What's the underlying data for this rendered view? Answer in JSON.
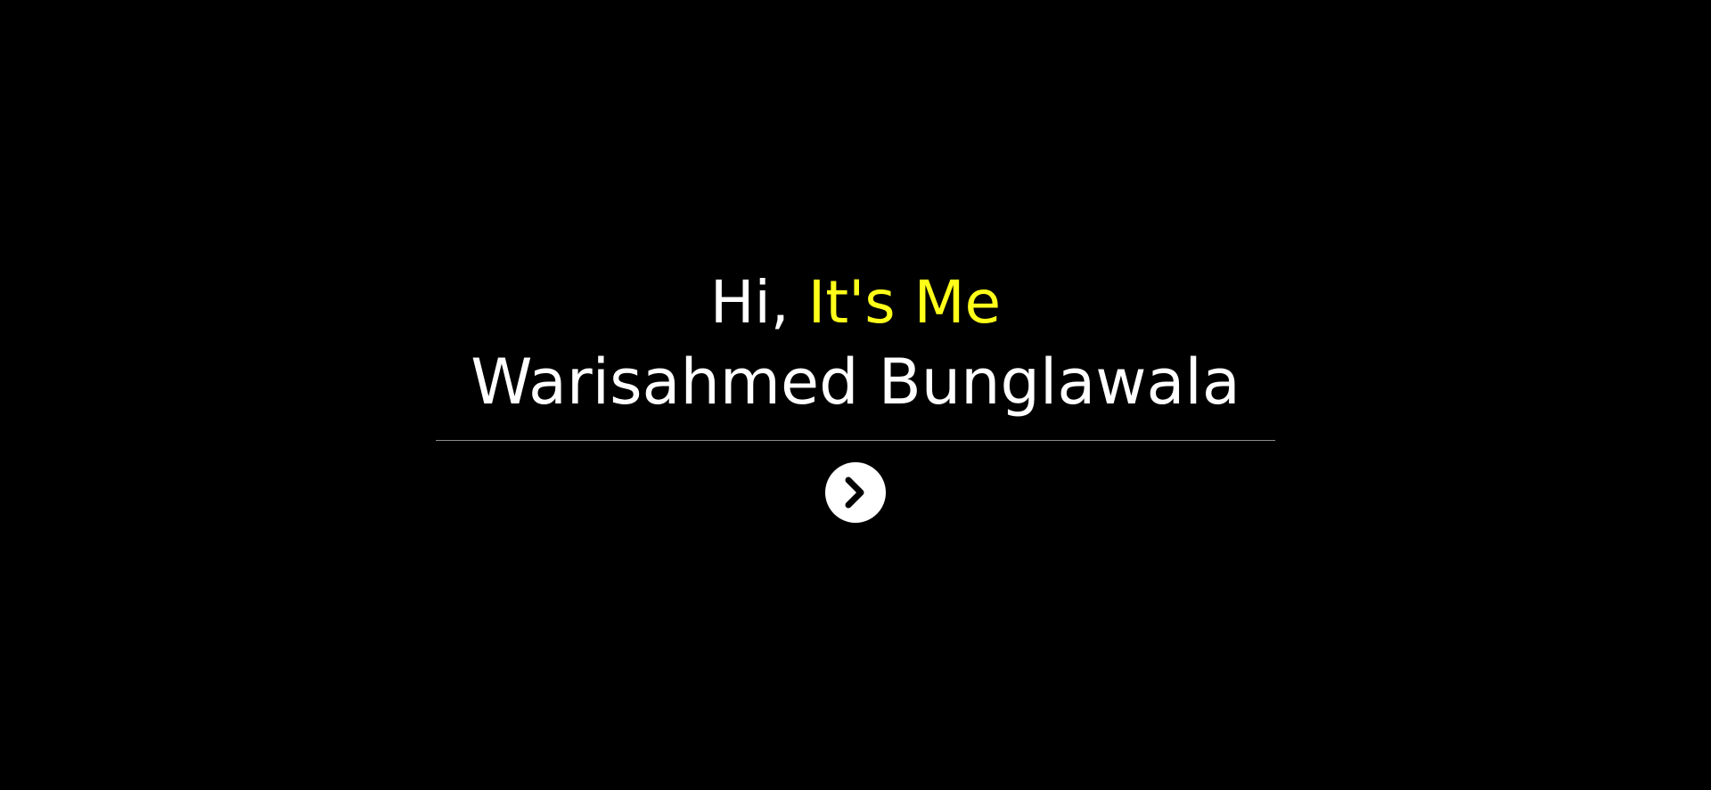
{
  "hero": {
    "greeting_prefix": "Hi, ",
    "greeting_accent": "It's Me",
    "name": "Warisahmed Bunglawala",
    "next_icon": "chevron-right-circle-icon"
  },
  "colors": {
    "background": "#000000",
    "text": "#ffffff",
    "accent": "#ffff1a",
    "divider": "#8a8a8a"
  }
}
